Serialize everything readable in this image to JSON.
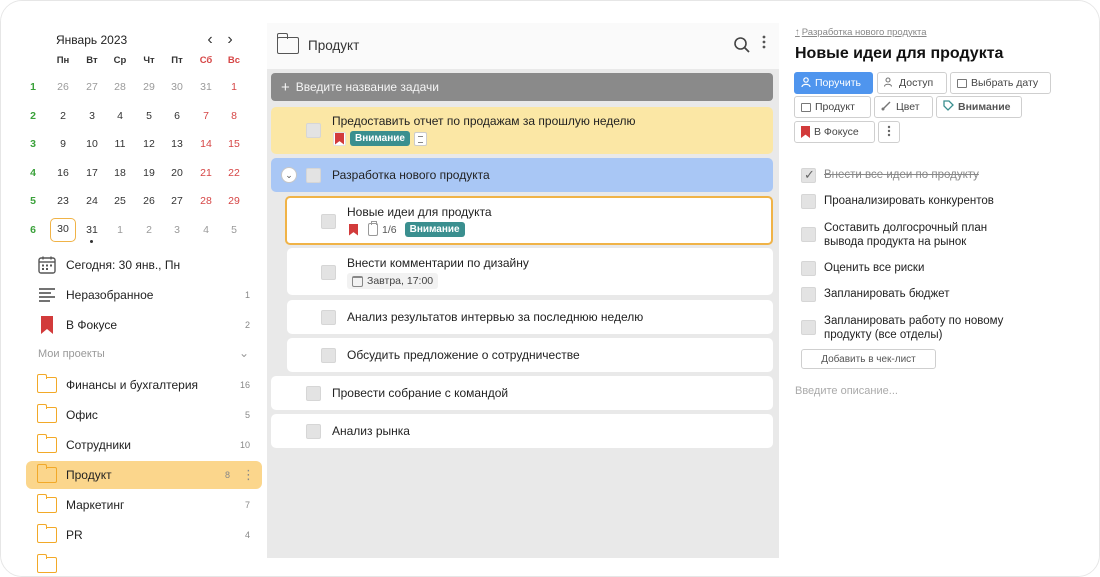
{
  "calendar": {
    "title": "Январь 2023",
    "prev_icon": "chevron-left-icon",
    "next_icon": "chevron-right-icon",
    "day_headers": [
      "Пн",
      "Вт",
      "Ср",
      "Чт",
      "Пт",
      "Сб",
      "Вс"
    ],
    "weeks": [
      {
        "num": "1",
        "days": [
          "26",
          "27",
          "28",
          "29",
          "30",
          "31",
          "1"
        ]
      },
      {
        "num": "2",
        "days": [
          "2",
          "3",
          "4",
          "5",
          "6",
          "7",
          "8"
        ]
      },
      {
        "num": "3",
        "days": [
          "9",
          "10",
          "11",
          "12",
          "13",
          "14",
          "15"
        ]
      },
      {
        "num": "4",
        "days": [
          "16",
          "17",
          "18",
          "19",
          "20",
          "21",
          "22"
        ]
      },
      {
        "num": "5",
        "days": [
          "23",
          "24",
          "25",
          "26",
          "27",
          "28",
          "29"
        ]
      },
      {
        "num": "6",
        "days": [
          "30",
          "31",
          "1",
          "2",
          "3",
          "4",
          "5"
        ]
      }
    ],
    "today_label": "Сегодня: 30 янв., Пн"
  },
  "sidebar": {
    "quick": [
      {
        "label": "Неразобранное",
        "count": "1",
        "icon": "inbox-lines-icon"
      },
      {
        "label": "В Фокусе",
        "count": "2",
        "icon": "bookmark-icon"
      }
    ],
    "projects_label": "Мои проекты",
    "projects": [
      {
        "label": "Финансы и бухгалтерия",
        "count": "16"
      },
      {
        "label": "Офис",
        "count": "5"
      },
      {
        "label": "Сотрудники",
        "count": "10"
      },
      {
        "label": "Продукт",
        "count": "8"
      },
      {
        "label": "Маркетинг",
        "count": "7"
      },
      {
        "label": "PR",
        "count": "4"
      }
    ]
  },
  "middle": {
    "title": "Продукт",
    "new_task_placeholder": "Введите название задачи",
    "tasks": [
      {
        "title": "Предоставить отчет по продажам за прошлую неделю",
        "badge": "Внимание"
      },
      {
        "title": "Разработка нового продукта"
      },
      {
        "title": "Новые идеи для продукта",
        "progress": "1/6",
        "badge": "Внимание"
      },
      {
        "title": "Внести комментарии по дизайну",
        "due": "Завтра, 17:00"
      },
      {
        "title": "Анализ результатов интервью за последнюю неделю"
      },
      {
        "title": "Обсудить предложение о сотрудничестве"
      },
      {
        "title": "Провести собрание с командой"
      },
      {
        "title": "Анализ рынка"
      }
    ]
  },
  "detail": {
    "breadcrumb": "Разработка нового продукта",
    "title": "Новые идеи для продукта",
    "buttons": {
      "assign": "Поручить",
      "access": "Доступ",
      "date": "Выбрать дату",
      "project": "Продукт",
      "color": "Цвет",
      "attention": "Внимание",
      "focus": "В Фокусе"
    },
    "checklist": [
      {
        "text": "Внести все идеи по продукту",
        "done": true
      },
      {
        "text": "Проанализировать конкурентов",
        "done": false
      },
      {
        "text": "Составить долгосрочный план вывода продукта на рынок",
        "done": false
      },
      {
        "text": "Оценить все риски",
        "done": false
      },
      {
        "text": "Запланировать бюджет",
        "done": false
      },
      {
        "text": "Запланировать работу по новому продукту (все отделы)",
        "done": false
      }
    ],
    "add_checklist": "Добавить в чек-лист",
    "description_placeholder": "Введите описание..."
  },
  "colors": {
    "accent": "#4f95ee",
    "highlight_yellow": "#fbe7a5",
    "selected_blue": "#a9c7f5",
    "focus_border": "#f0b347",
    "badge_teal": "#3a8f8f",
    "weekend_red": "#d64545",
    "week_green": "#3aa13a"
  }
}
